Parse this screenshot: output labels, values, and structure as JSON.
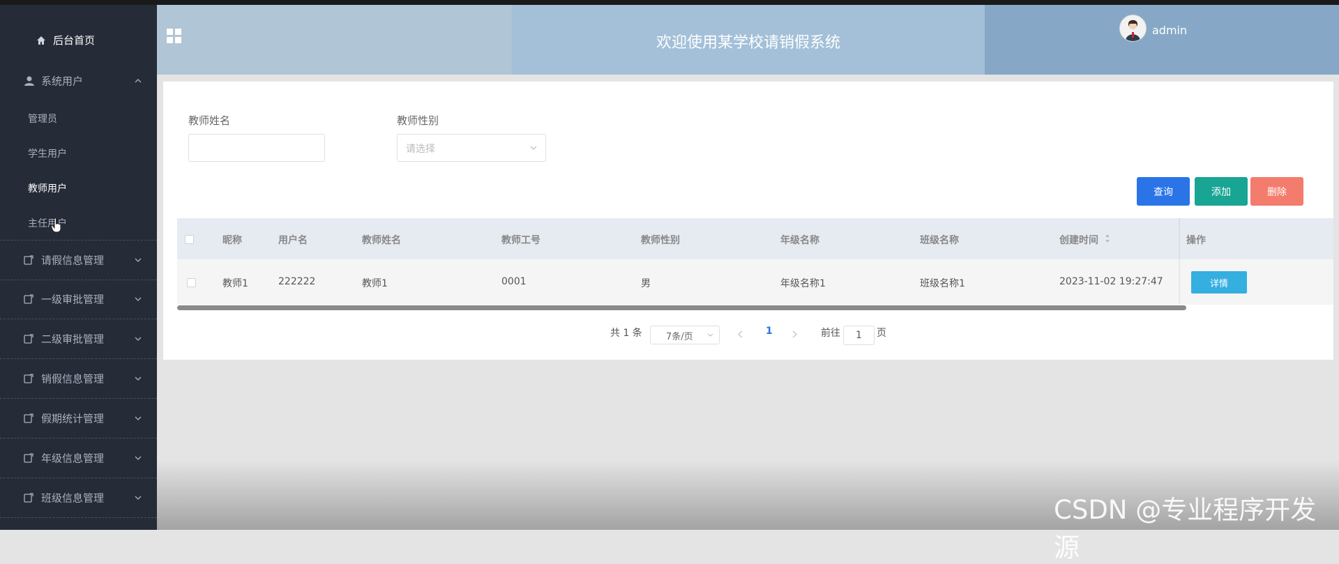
{
  "header": {
    "title": "欢迎使用某学校请销假系统",
    "user": "admin"
  },
  "sidebar": {
    "home": "后台首页",
    "groups": [
      {
        "label": "系统用户"
      },
      {
        "label": "请假信息管理"
      },
      {
        "label": "一级审批管理"
      },
      {
        "label": "二级审批管理"
      },
      {
        "label": "销假信息管理"
      },
      {
        "label": "假期统计管理"
      },
      {
        "label": "年级信息管理"
      },
      {
        "label": "班级信息管理"
      }
    ],
    "sub_items": [
      {
        "label": "管理员"
      },
      {
        "label": "学生用户"
      },
      {
        "label": "教师用户"
      },
      {
        "label": "主任用户"
      }
    ]
  },
  "search": {
    "name_label": "教师姓名",
    "name_value": "",
    "gender_label": "教师性别",
    "gender_placeholder": "请选择"
  },
  "buttons": {
    "query": "查询",
    "add": "添加",
    "delete": "删除"
  },
  "table": {
    "headers": [
      "昵称",
      "用户名",
      "教师姓名",
      "教师工号",
      "教师性别",
      "年级名称",
      "班级名称",
      "创建时间",
      "操作"
    ],
    "rows": [
      [
        "教师1",
        "222222",
        "教师1",
        "0001",
        "男",
        "年级名称1",
        "班级名称1",
        "2023-11-02 19:27:47"
      ]
    ],
    "detail_label": "详情"
  },
  "pagination": {
    "total_text": "共 1 条",
    "page_size": "7条/页",
    "current_page": "1",
    "goto_label": "前往",
    "goto_value": "1",
    "page_suffix": "页"
  },
  "watermark": "CSDN @专业程序开发源"
}
